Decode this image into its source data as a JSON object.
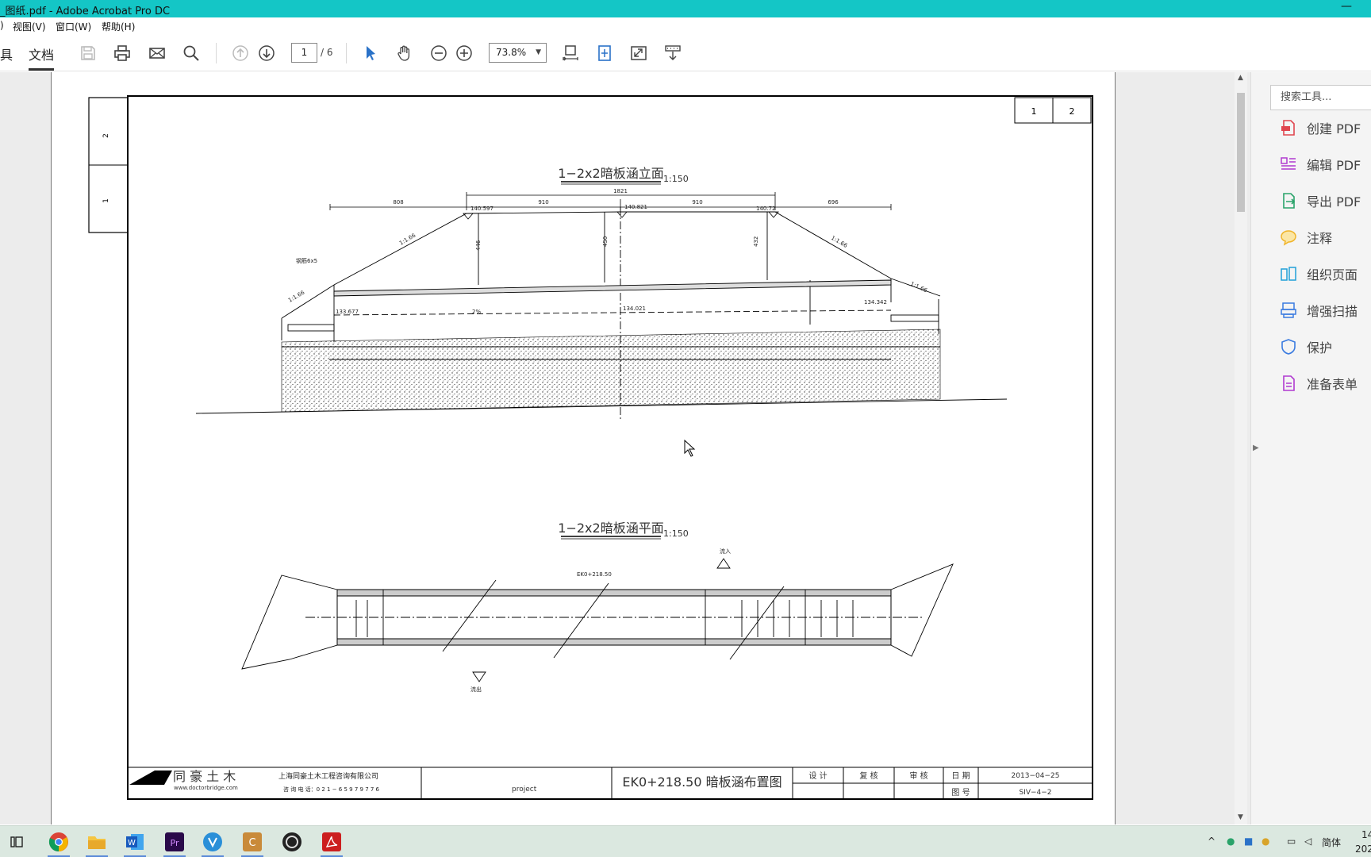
{
  "window": {
    "title": "_图纸.pdf - Adobe Acrobat Pro DC",
    "minimize": "—"
  },
  "menu": [
    "视图(V)",
    "窗口(W)",
    "帮助(H)"
  ],
  "menu_left_fragment": ")",
  "toolbar": {
    "tool_tab_fragment": "具",
    "doc_tab": "文档",
    "page_current": "1",
    "page_total": "/ 6",
    "zoom": "73.8%"
  },
  "drawing": {
    "sheet_numbers": [
      "1",
      "2"
    ],
    "side_numbers": [
      "2",
      "1"
    ],
    "elevation_title": "1−2x2暗板涵立面",
    "elevation_scale": "1:150",
    "plan_title": "1−2x2暗板涵平面",
    "plan_scale": "1:150",
    "dims": [
      "808",
      "910",
      "910",
      "696",
      "1821"
    ],
    "elevations": [
      "140.597",
      "140.821",
      "140.72",
      "133.677",
      "134.021",
      "134.342"
    ],
    "heights": [
      "446",
      "450",
      "432"
    ],
    "slopes": [
      "1:1.66",
      "1:1.66",
      "1:1.66",
      "1:1.66"
    ],
    "gradient": "2%",
    "plan_station": "EK0+218.50",
    "plan_flow_in": "流入",
    "plan_flow_out": "流出",
    "steel_label": "钢筋6x5"
  },
  "titleblock": {
    "logo_text": "同 豪 土 木",
    "website": "www.doctorbridge.com",
    "company": "上海同豪土木工程咨询有限公司",
    "phone": "咨 询 电 话：0 2 1 − 6 5 9 7 9 7 7 6",
    "project": "project",
    "drawing_name": "EK0+218.50 暗板涵布置图",
    "design": "设 计",
    "check": "复 核",
    "review": "审 核",
    "date_label": "日 期",
    "date_value": "2013−04−25",
    "number_label": "图 号",
    "number_value": "SIV−4−2"
  },
  "right_panel": {
    "search_placeholder": "搜索工具...",
    "tools": [
      {
        "label": "创建 PDF",
        "icon": "create-pdf-icon",
        "color": "#e0464f"
      },
      {
        "label": "编辑 PDF",
        "icon": "edit-pdf-icon",
        "color": "#b03ad0"
      },
      {
        "label": "导出 PDF",
        "icon": "export-pdf-icon",
        "color": "#2aa36a"
      },
      {
        "label": "注释",
        "icon": "comment-icon",
        "color": "#f0b429"
      },
      {
        "label": "组织页面",
        "icon": "organize-pages-icon",
        "color": "#20a0d8"
      },
      {
        "label": "增强扫描",
        "icon": "enhance-scan-icon",
        "color": "#3a7be0"
      },
      {
        "label": "保护",
        "icon": "protect-icon",
        "color": "#3a7be0"
      },
      {
        "label": "准备表单",
        "icon": "prepare-form-icon",
        "color": "#b03ad0"
      }
    ]
  },
  "taskbar": {
    "ime": "简体",
    "time_fragment": "14",
    "date_fragment": "202"
  },
  "colors": {
    "titlebar": "#14c6c6",
    "taskbar": "#dbe8e0"
  }
}
